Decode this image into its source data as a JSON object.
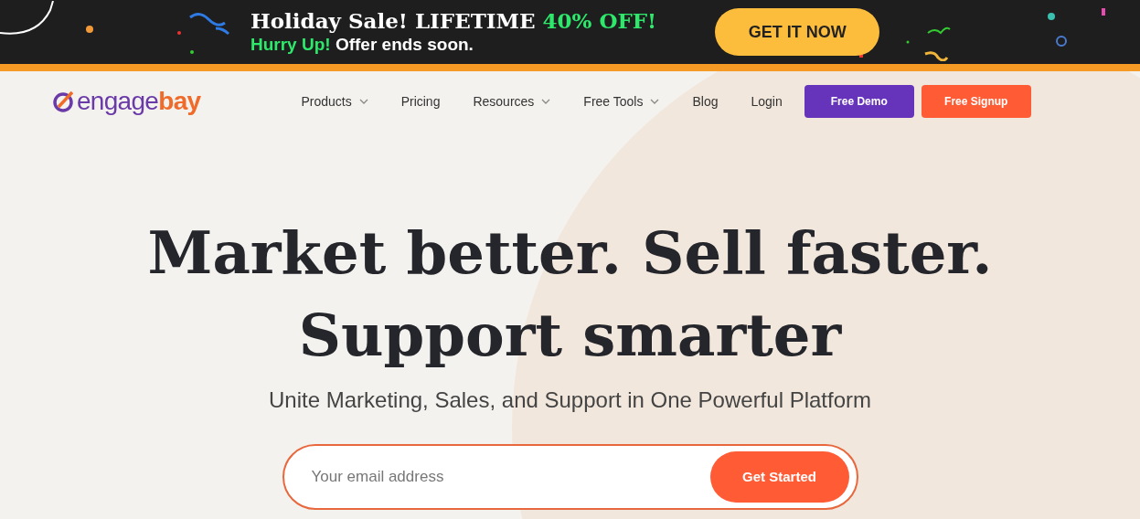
{
  "promo_banner": {
    "title": "Holiday Sale! LIFETIME",
    "title_highlight": "40% OFF!",
    "subtitle_highlight": "Hurry Up!",
    "subtitle": "Offer ends soon.",
    "button": "GET IT NOW"
  },
  "header": {
    "logo": {
      "part1": "engage",
      "part2": "bay"
    },
    "nav": [
      {
        "label": "Products",
        "has_menu": true
      },
      {
        "label": "Pricing",
        "has_menu": false
      },
      {
        "label": "Resources",
        "has_menu": true
      },
      {
        "label": "Free Tools",
        "has_menu": true
      },
      {
        "label": "Blog",
        "has_menu": false
      },
      {
        "label": "Login",
        "has_menu": false
      }
    ],
    "buttons": [
      {
        "label": "Free Demo",
        "kind": "demo"
      },
      {
        "label": "Free Signup",
        "kind": "signup"
      }
    ]
  },
  "hero": {
    "headline_lines": [
      "Market better. Sell faster.",
      "Support smarter"
    ],
    "subheadline": "Unite Marketing, Sales, and Support in One Powerful Platform",
    "email_form": {
      "placeholder": "Your email address",
      "button": "Get Started"
    }
  }
}
